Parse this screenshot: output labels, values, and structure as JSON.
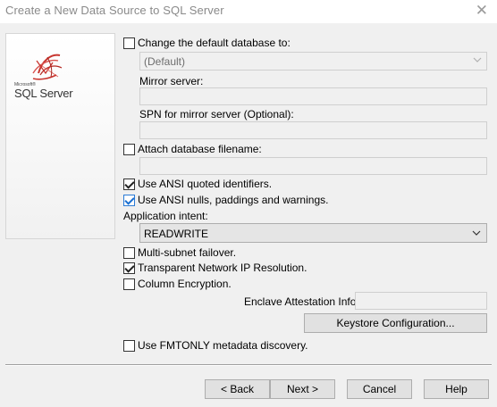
{
  "window": {
    "title": "Create a New Data Source to SQL Server",
    "close_glyph": "✕"
  },
  "logo": {
    "small_text": "Microsoft®",
    "product": "SQL Server"
  },
  "options": {
    "change_default_db": {
      "label": "Change the default database to:",
      "checked": false
    },
    "default_db_select": {
      "value": "(Default)"
    },
    "mirror_server": {
      "label": "Mirror server:",
      "value": ""
    },
    "spn_mirror": {
      "label": "SPN for mirror server (Optional):",
      "value": ""
    },
    "attach_db": {
      "label": "Attach database filename:",
      "checked": false,
      "value": ""
    },
    "ansi_quoted": {
      "label": "Use ANSI quoted identifiers.",
      "checked": true
    },
    "ansi_nulls": {
      "label": "Use ANSI nulls, paddings and warnings.",
      "checked": true
    },
    "app_intent": {
      "label": "Application intent:",
      "value": "READWRITE"
    },
    "multi_subnet": {
      "label": "Multi-subnet failover.",
      "checked": false
    },
    "tnir": {
      "label": "Transparent Network IP Resolution.",
      "checked": true
    },
    "column_encryption": {
      "label": "Column Encryption.",
      "checked": false
    },
    "enclave": {
      "label": "Enclave Attestation Info:",
      "value": ""
    },
    "keystore_button": "Keystore Configuration...",
    "fmtonly": {
      "label": "Use FMTONLY metadata discovery.",
      "checked": false
    }
  },
  "buttons": {
    "back": "< Back",
    "next": "Next >",
    "cancel": "Cancel",
    "help": "Help"
  },
  "colors": {
    "logo_red": "#c8352f",
    "focus_blue": "#2b7bd6",
    "window_bg": "#f0f0f0"
  }
}
